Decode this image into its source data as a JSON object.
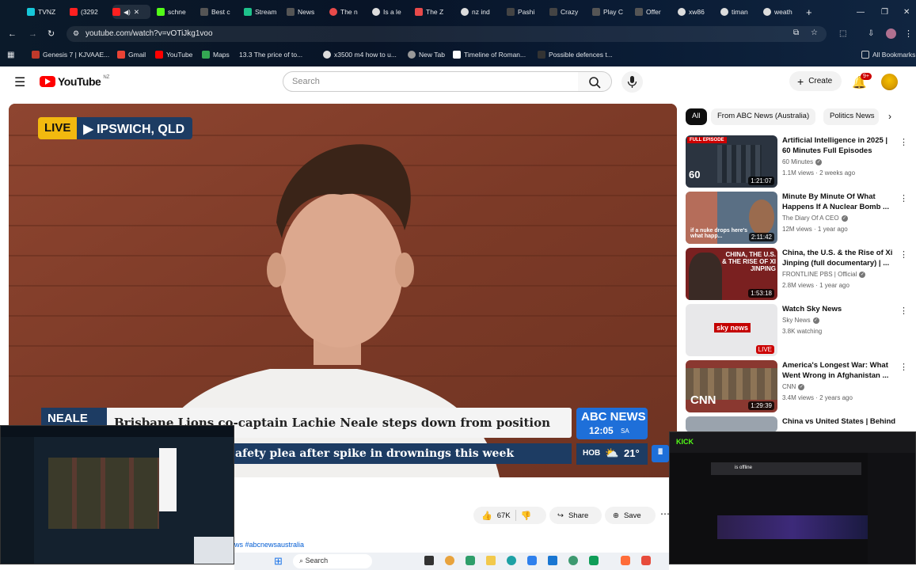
{
  "browser": {
    "tabs": [
      "TVNZ",
      "(3292",
      "schne",
      "Best c",
      "Stream",
      "News",
      "The n",
      "Is a le",
      "The Z",
      "nz ind",
      "Pashi",
      "Crazy",
      "Play C",
      "Offer",
      "xw86",
      "timan",
      "weath"
    ],
    "url": "youtube.com/watch?v=vOTiJkg1voo",
    "bookmarks": [
      "Genesis 7 | KJVAAE...",
      "Gmail",
      "YouTube",
      "Maps",
      "13.3 The price of to...",
      "x3500 m4 how to u...",
      "New Tab",
      "Timeline of Roman...",
      "Possible defences t..."
    ],
    "all_bookmarks": "All Bookmarks"
  },
  "youtube": {
    "logo": "YouTube",
    "region": "NZ",
    "search_placeholder": "Search",
    "create_label": "Create",
    "notifications": "9+"
  },
  "video": {
    "live_badge": "LIVE",
    "location": "IPSWICH, QLD",
    "name_tag": "NEALE",
    "headline": "Brisbane Lions co-captain Lachie Neale steps down from position",
    "ticker": "afety plea after spike in drownings this week",
    "network": "ABC NEWS",
    "time": "12:05",
    "timezone": "SA",
    "weather_city": "HOB",
    "temperature": "21°"
  },
  "chips": [
    "All",
    "From ABC News (Australia)",
    "Politics News"
  ],
  "recommendations": [
    {
      "title": "Artificial Intelligence in 2025 | 60 Minutes Full Episodes",
      "channel": "60 Minutes",
      "meta": "1.1M views · 2 weeks ago",
      "duration": "1:21:07",
      "thumb_color": "#2b3440",
      "badge": "FULL EPISODE"
    },
    {
      "title": "Minute By Minute Of What Happens If A Nuclear Bomb ...",
      "channel": "The Diary Of A CEO",
      "meta": "12M views · 1 year ago",
      "duration": "2:11:42",
      "thumb_color": "#5a6f84",
      "badge": "if a nuke drops here's what happ..."
    },
    {
      "title": "China, the U.S. & the Rise of Xi Jinping (full documentary) | ...",
      "channel": "FRONTLINE PBS | Official",
      "meta": "2.8M views · 1 year ago",
      "duration": "1:53:18",
      "thumb_color": "#7a2020",
      "badge": "CHINA, THE U.S. & THE RISE OF XI JINPING"
    },
    {
      "title": "Watch Sky News",
      "channel": "Sky News",
      "meta": "3.8K watching",
      "duration": "LIVE",
      "thumb_color": "#e8e8ea",
      "badge": "sky news"
    },
    {
      "title": "America's Longest War: What Went Wrong in Afghanistan ...",
      "channel": "CNN",
      "meta": "3.4M views · 2 years ago",
      "duration": "1:29:39",
      "thumb_color": "#8a3830",
      "badge": "CNN"
    },
    {
      "title": "China vs United States | Behind",
      "channel": "",
      "meta": "",
      "duration": "",
      "thumb_color": "#9aa3ad",
      "badge": ""
    }
  ],
  "actions": {
    "likes": "67K",
    "share": "Share",
    "save": "Save"
  },
  "description_snippet": "ws #abcnewsaustralia",
  "taskbar": {
    "search": "Search"
  },
  "overlay_right": {
    "platform": "KICK",
    "status": "is offline"
  }
}
